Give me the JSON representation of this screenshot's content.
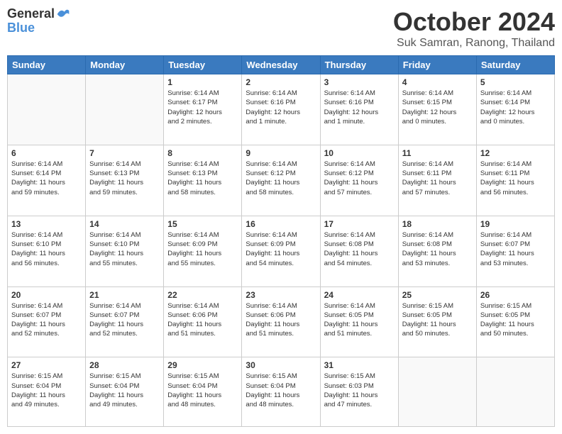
{
  "logo": {
    "line1": "General",
    "line2": "Blue"
  },
  "title": "October 2024",
  "subtitle": "Suk Samran, Ranong, Thailand",
  "days_header": [
    "Sunday",
    "Monday",
    "Tuesday",
    "Wednesday",
    "Thursday",
    "Friday",
    "Saturday"
  ],
  "weeks": [
    [
      {
        "num": "",
        "info": ""
      },
      {
        "num": "",
        "info": ""
      },
      {
        "num": "1",
        "info": "Sunrise: 6:14 AM\nSunset: 6:17 PM\nDaylight: 12 hours\nand 2 minutes."
      },
      {
        "num": "2",
        "info": "Sunrise: 6:14 AM\nSunset: 6:16 PM\nDaylight: 12 hours\nand 1 minute."
      },
      {
        "num": "3",
        "info": "Sunrise: 6:14 AM\nSunset: 6:16 PM\nDaylight: 12 hours\nand 1 minute."
      },
      {
        "num": "4",
        "info": "Sunrise: 6:14 AM\nSunset: 6:15 PM\nDaylight: 12 hours\nand 0 minutes."
      },
      {
        "num": "5",
        "info": "Sunrise: 6:14 AM\nSunset: 6:14 PM\nDaylight: 12 hours\nand 0 minutes."
      }
    ],
    [
      {
        "num": "6",
        "info": "Sunrise: 6:14 AM\nSunset: 6:14 PM\nDaylight: 11 hours\nand 59 minutes."
      },
      {
        "num": "7",
        "info": "Sunrise: 6:14 AM\nSunset: 6:13 PM\nDaylight: 11 hours\nand 59 minutes."
      },
      {
        "num": "8",
        "info": "Sunrise: 6:14 AM\nSunset: 6:13 PM\nDaylight: 11 hours\nand 58 minutes."
      },
      {
        "num": "9",
        "info": "Sunrise: 6:14 AM\nSunset: 6:12 PM\nDaylight: 11 hours\nand 58 minutes."
      },
      {
        "num": "10",
        "info": "Sunrise: 6:14 AM\nSunset: 6:12 PM\nDaylight: 11 hours\nand 57 minutes."
      },
      {
        "num": "11",
        "info": "Sunrise: 6:14 AM\nSunset: 6:11 PM\nDaylight: 11 hours\nand 57 minutes."
      },
      {
        "num": "12",
        "info": "Sunrise: 6:14 AM\nSunset: 6:11 PM\nDaylight: 11 hours\nand 56 minutes."
      }
    ],
    [
      {
        "num": "13",
        "info": "Sunrise: 6:14 AM\nSunset: 6:10 PM\nDaylight: 11 hours\nand 56 minutes."
      },
      {
        "num": "14",
        "info": "Sunrise: 6:14 AM\nSunset: 6:10 PM\nDaylight: 11 hours\nand 55 minutes."
      },
      {
        "num": "15",
        "info": "Sunrise: 6:14 AM\nSunset: 6:09 PM\nDaylight: 11 hours\nand 55 minutes."
      },
      {
        "num": "16",
        "info": "Sunrise: 6:14 AM\nSunset: 6:09 PM\nDaylight: 11 hours\nand 54 minutes."
      },
      {
        "num": "17",
        "info": "Sunrise: 6:14 AM\nSunset: 6:08 PM\nDaylight: 11 hours\nand 54 minutes."
      },
      {
        "num": "18",
        "info": "Sunrise: 6:14 AM\nSunset: 6:08 PM\nDaylight: 11 hours\nand 53 minutes."
      },
      {
        "num": "19",
        "info": "Sunrise: 6:14 AM\nSunset: 6:07 PM\nDaylight: 11 hours\nand 53 minutes."
      }
    ],
    [
      {
        "num": "20",
        "info": "Sunrise: 6:14 AM\nSunset: 6:07 PM\nDaylight: 11 hours\nand 52 minutes."
      },
      {
        "num": "21",
        "info": "Sunrise: 6:14 AM\nSunset: 6:07 PM\nDaylight: 11 hours\nand 52 minutes."
      },
      {
        "num": "22",
        "info": "Sunrise: 6:14 AM\nSunset: 6:06 PM\nDaylight: 11 hours\nand 51 minutes."
      },
      {
        "num": "23",
        "info": "Sunrise: 6:14 AM\nSunset: 6:06 PM\nDaylight: 11 hours\nand 51 minutes."
      },
      {
        "num": "24",
        "info": "Sunrise: 6:14 AM\nSunset: 6:05 PM\nDaylight: 11 hours\nand 51 minutes."
      },
      {
        "num": "25",
        "info": "Sunrise: 6:15 AM\nSunset: 6:05 PM\nDaylight: 11 hours\nand 50 minutes."
      },
      {
        "num": "26",
        "info": "Sunrise: 6:15 AM\nSunset: 6:05 PM\nDaylight: 11 hours\nand 50 minutes."
      }
    ],
    [
      {
        "num": "27",
        "info": "Sunrise: 6:15 AM\nSunset: 6:04 PM\nDaylight: 11 hours\nand 49 minutes."
      },
      {
        "num": "28",
        "info": "Sunrise: 6:15 AM\nSunset: 6:04 PM\nDaylight: 11 hours\nand 49 minutes."
      },
      {
        "num": "29",
        "info": "Sunrise: 6:15 AM\nSunset: 6:04 PM\nDaylight: 11 hours\nand 48 minutes."
      },
      {
        "num": "30",
        "info": "Sunrise: 6:15 AM\nSunset: 6:04 PM\nDaylight: 11 hours\nand 48 minutes."
      },
      {
        "num": "31",
        "info": "Sunrise: 6:15 AM\nSunset: 6:03 PM\nDaylight: 11 hours\nand 47 minutes."
      },
      {
        "num": "",
        "info": ""
      },
      {
        "num": "",
        "info": ""
      }
    ]
  ]
}
